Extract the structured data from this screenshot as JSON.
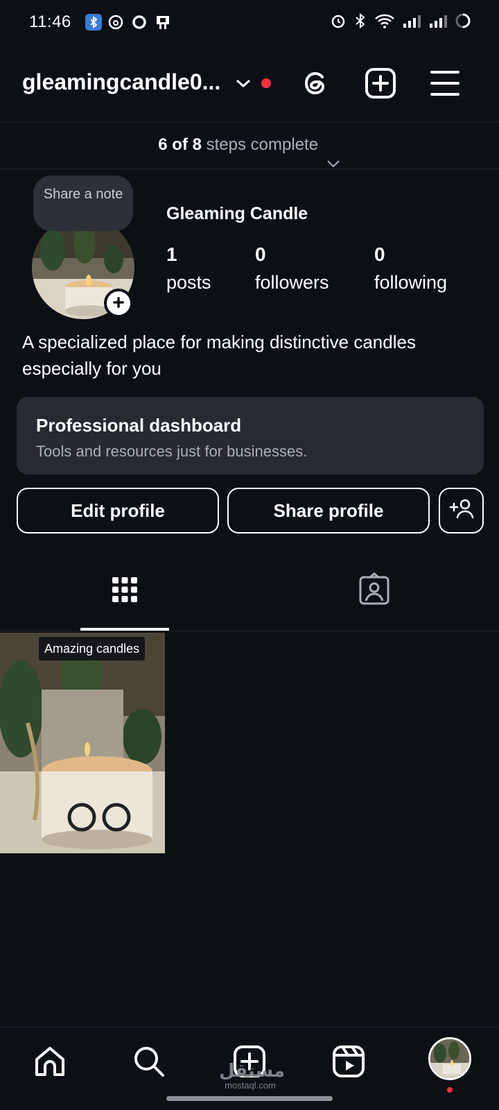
{
  "status_bar": {
    "time": "11:46",
    "left_icons": [
      "bluetooth-badge-icon",
      "threads-icon",
      "circle-icon",
      "clipboard-icon"
    ],
    "right_icons": [
      "alarm-icon",
      "bluetooth-icon",
      "wifi-icon",
      "signal-icon",
      "signal-icon",
      "battery-ring-icon"
    ]
  },
  "header": {
    "username": "gleamingcandle0...",
    "icons": [
      "chevron-down-icon",
      "threads-icon",
      "create-plus-icon",
      "menu-icon"
    ],
    "notification_dot_color": "#ff3040"
  },
  "steps": {
    "done": "6 of 8",
    "label": "steps complete"
  },
  "profile": {
    "note_bubble": "Share a note",
    "display_name": "Gleaming Candle",
    "stats": [
      {
        "value": "1",
        "label": "posts"
      },
      {
        "value": "0",
        "label": "followers"
      },
      {
        "value": "0",
        "label": "following"
      }
    ],
    "bio": "A specialized place for making distinctive candles especially for you"
  },
  "dashboard": {
    "title": "Professional dashboard",
    "subtitle": "Tools and resources just for businesses."
  },
  "buttons": {
    "edit": "Edit profile",
    "share": "Share profile"
  },
  "tabs": [
    "grid-icon",
    "tagged-icon"
  ],
  "posts": [
    {
      "label": "Amazing candles"
    }
  ],
  "bottom_nav": [
    "home-icon",
    "search-icon",
    "create-icon",
    "reels-icon",
    "profile-avatar"
  ],
  "watermark": {
    "arabic": "مستقل",
    "latin": "mostaql.com"
  },
  "colors": {
    "background": "#0c0f14",
    "card": "#262a31",
    "accent_red": "#ff3040",
    "bluetooth_badge": "#3a7bd5"
  }
}
